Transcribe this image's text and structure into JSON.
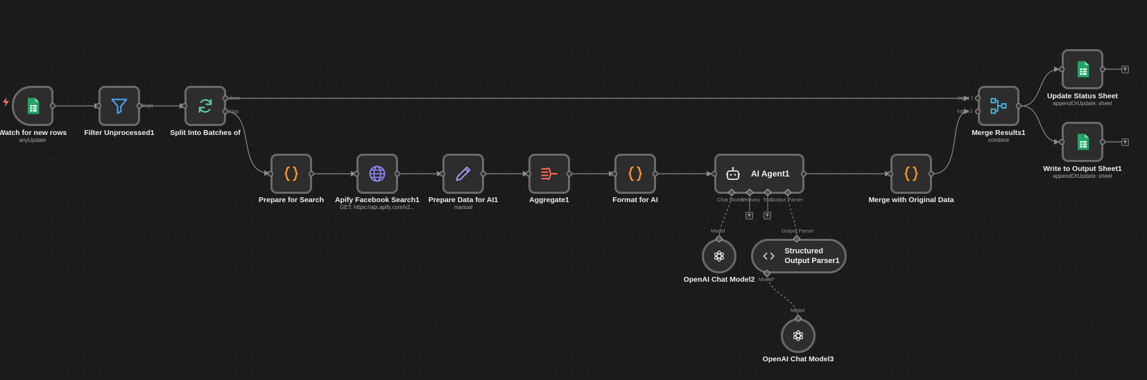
{
  "nodes": {
    "watch": {
      "label": "Watch for new rows",
      "sub": "anyUpdate",
      "icon": "google-sheets-icon"
    },
    "filter": {
      "label": "Filter Unprocessed1",
      "icon": "filter-icon"
    },
    "split": {
      "label": "Split Into Batches of",
      "icon": "loop-icon"
    },
    "prepare_search": {
      "label": "Prepare for Search",
      "icon": "code-braces-icon"
    },
    "apify": {
      "label": "Apify Facebook Search1",
      "sub": "GET: https://api.apify.com/v2...",
      "icon": "globe-icon"
    },
    "prepare_ai": {
      "label": "Prepare Data for AI1",
      "sub": "manual",
      "icon": "pencil-icon"
    },
    "aggregate": {
      "label": "Aggregate1",
      "icon": "aggregate-icon"
    },
    "format_ai": {
      "label": "Format for AI",
      "icon": "code-braces-icon"
    },
    "agent": {
      "label": "AI Agent1",
      "icon": "robot-icon"
    },
    "merge_original": {
      "label": "Merge with Original Data",
      "icon": "code-braces-icon"
    },
    "merge_results": {
      "label": "Merge Results1",
      "sub": "combine",
      "icon": "merge-icon"
    },
    "update_status": {
      "label": "Update Status Sheet",
      "sub": "appendOrUpdate: sheet",
      "icon": "google-sheets-icon"
    },
    "write_output": {
      "label": "Write to Output Sheet1",
      "sub": "appendOrUpdate: sheet",
      "icon": "google-sheets-icon"
    },
    "openai2": {
      "label": "OpenAI Chat Model2",
      "icon": "openai-icon"
    },
    "parser": {
      "label": "Structured Output Parser1",
      "icon": "code-brackets-icon"
    },
    "openai3": {
      "label": "OpenAI Chat Model3",
      "icon": "openai-icon"
    }
  },
  "tags": {
    "kept": "Kept",
    "done": "done",
    "loop": "loop",
    "input1": "Input 1",
    "input2": "Input 2",
    "chat_model": "Chat Model",
    "memory": "Memory",
    "tool": "Tool",
    "output_parser": "Output Parser",
    "model": "Model",
    "output_parser_in": "Output Parser",
    "model_req": "Model",
    "model_in": "Model"
  },
  "colors": {
    "sheets_green": "#21a464",
    "filter_blue": "#4aa3f0",
    "loop_teal": "#5ec7b0",
    "code_orange": "#ff9b21",
    "globe_purple": "#8f86f5",
    "pencil_lavender": "#a59cf5",
    "aggregate_red": "#ff6a55",
    "merge_blue": "#46b7e6",
    "edge": "#8a8a8a",
    "trigger_bolt": "#ff6d5a"
  }
}
